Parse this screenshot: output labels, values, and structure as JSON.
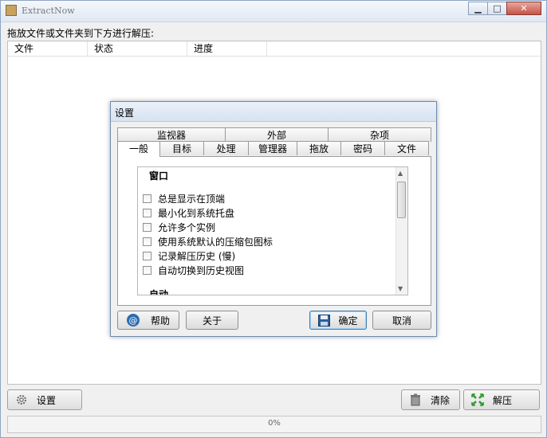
{
  "window": {
    "title": "ExtractNow",
    "min_label": "▭",
    "max_label": "□",
    "close_label": "✕"
  },
  "main": {
    "instruction": "拖放文件或文件夹到下方进行解压:",
    "columns": [
      "文件",
      "状态",
      "进度"
    ],
    "settings_button": "设置",
    "clear_button": "清除",
    "extract_button": "解压",
    "status_text": "0%"
  },
  "dialog": {
    "title": "设置",
    "tabs_row1": [
      "监视器",
      "外部",
      "杂项"
    ],
    "tabs_row2": [
      "一般",
      "目标",
      "处理",
      "管理器",
      "拖放",
      "密码",
      "文件"
    ],
    "active_tab": "一般",
    "section_window": "窗口",
    "options": [
      {
        "label": "总是显示在顶端",
        "checked": false
      },
      {
        "label": "最小化到系统托盘",
        "checked": false
      },
      {
        "label": "允许多个实例",
        "checked": false
      },
      {
        "label": "使用系统默认的压缩包图标",
        "checked": false
      },
      {
        "label": "记录解压历史 (慢)",
        "checked": false
      },
      {
        "label": "自动切换到历史视图",
        "checked": false
      }
    ],
    "section_next": "自动",
    "help_button": "帮助",
    "about_button": "关于",
    "ok_button": "确定",
    "cancel_button": "取消"
  },
  "icons": {
    "app": "box-icon",
    "settings": "gear-icon",
    "clear": "trash-icon",
    "extract": "extract-arrows-icon",
    "help": "at-sign-icon",
    "ok": "floppy-disk-icon"
  },
  "colors": {
    "accent_green": "#2e9a2e",
    "close_red": "#c45448",
    "dialog_border": "#6c8bb0"
  }
}
